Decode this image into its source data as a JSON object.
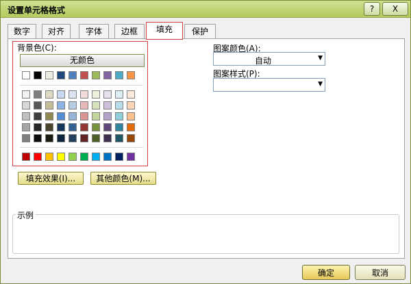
{
  "window": {
    "title": "设置单元格格式",
    "help_glyph": "?",
    "close_glyph": "X"
  },
  "tabs": [
    {
      "label": "数字"
    },
    {
      "label": "对齐"
    },
    {
      "label": "字体"
    },
    {
      "label": "边框"
    },
    {
      "label": "填充"
    },
    {
      "label": "保护"
    }
  ],
  "fill": {
    "background_label": "背景色(C):",
    "no_color_label": "无颜色",
    "pattern_color_label": "图案颜色(A):",
    "pattern_color_value": "自动",
    "pattern_style_label": "图案样式(P):",
    "pattern_style_value": "",
    "fill_effects_button": "填充效果(I)...",
    "more_colors_button": "其他颜色(M)...",
    "sample_label": "示例"
  },
  "palette": {
    "theme_row": [
      "#ffffff",
      "#000000",
      "#eeece1",
      "#1f497d",
      "#4f81bd",
      "#c0504d",
      "#9bbb59",
      "#8064a2",
      "#4bacc6",
      "#f79646"
    ],
    "tints": [
      [
        "#f2f2f2",
        "#7f7f7f",
        "#ddd9c3",
        "#c6d9f0",
        "#dbe5f1",
        "#f2dcdb",
        "#ebf1dd",
        "#e5e0ec",
        "#dbeef3",
        "#fdeada"
      ],
      [
        "#d8d8d8",
        "#595959",
        "#c4bd97",
        "#8db3e2",
        "#b8cce4",
        "#e5b9b7",
        "#d7e3bc",
        "#ccc1d9",
        "#b7dde8",
        "#fbd5b5"
      ],
      [
        "#bfbfbf",
        "#3f3f3f",
        "#938953",
        "#548dd4",
        "#95b3d7",
        "#d99694",
        "#c3d69b",
        "#b2a2c7",
        "#92cddc",
        "#fac08f"
      ],
      [
        "#a5a5a5",
        "#262626",
        "#494429",
        "#17365d",
        "#366092",
        "#953734",
        "#76923c",
        "#5f497a",
        "#31859b",
        "#e36c09"
      ],
      [
        "#7f7f7f",
        "#0c0c0c",
        "#1d1b10",
        "#0f243e",
        "#244061",
        "#632423",
        "#4f6128",
        "#3f3151",
        "#205867",
        "#974806"
      ]
    ],
    "standard_row": [
      "#c00000",
      "#ff0000",
      "#ffc000",
      "#ffff00",
      "#92d050",
      "#00b050",
      "#00b0f0",
      "#0070c0",
      "#002060",
      "#7030a0"
    ]
  },
  "footer": {
    "ok_label": "确定",
    "cancel_label": "取消"
  },
  "colors": {
    "titlebar": "#b3ca5e",
    "active_tab_border": "#d04040"
  }
}
